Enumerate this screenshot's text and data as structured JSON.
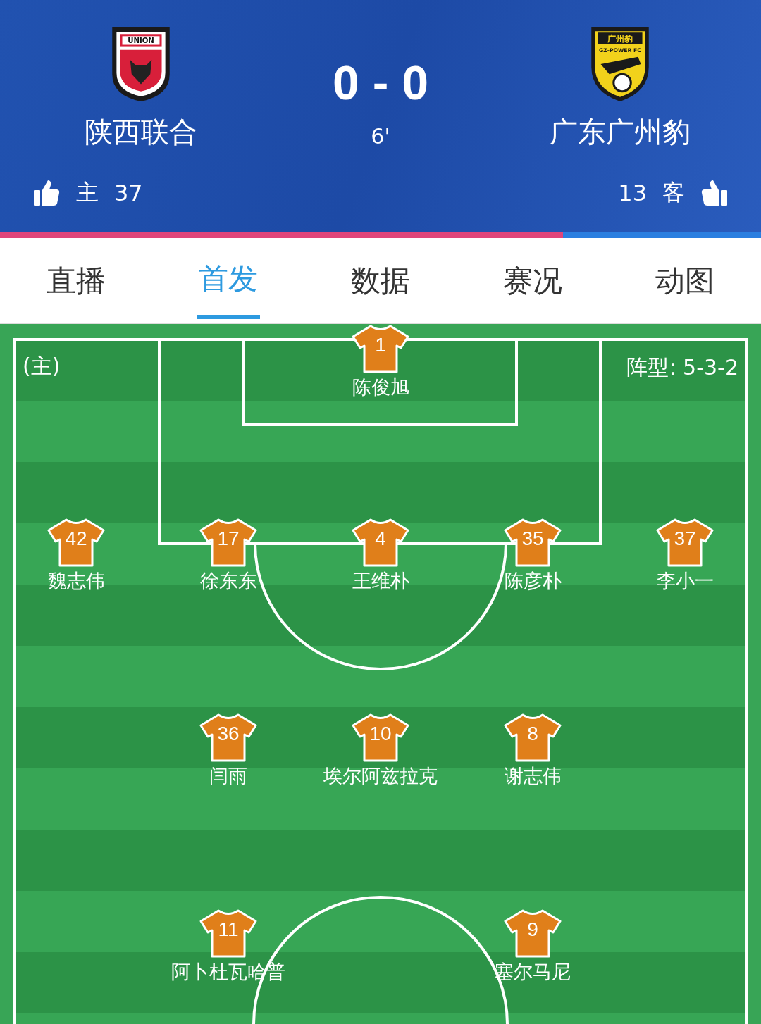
{
  "match": {
    "home": {
      "name": "陕西联合",
      "logo_text": "UNION",
      "side_label": "主",
      "likes": "37"
    },
    "away": {
      "name": "广东广州豹",
      "logo_text": "广州豹",
      "logo_subtext": "GZ-POWER FC",
      "side_label": "客",
      "likes": "13"
    },
    "score": "0 - 0",
    "minute": "6'",
    "support_bar": {
      "level": 0.74
    }
  },
  "tabs": [
    {
      "label": "直播",
      "selected": false
    },
    {
      "label": "首发",
      "selected": true
    },
    {
      "label": "数据",
      "selected": false
    },
    {
      "label": "赛况",
      "selected": false
    },
    {
      "label": "动图",
      "selected": false
    }
  ],
  "lineup": {
    "team_tag": "(主)",
    "formation": "阵型: 5-3-2",
    "rows": [
      [
        null,
        null,
        {
          "number": "1",
          "name": "陈俊旭"
        },
        null,
        null
      ],
      [
        {
          "number": "42",
          "name": "魏志伟"
        },
        {
          "number": "17",
          "name": "徐东东"
        },
        {
          "number": "4",
          "name": "王维朴"
        },
        {
          "number": "35",
          "name": "陈彦朴"
        },
        {
          "number": "37",
          "name": "李小一"
        }
      ],
      [
        null,
        {
          "number": "36",
          "name": "闫雨"
        },
        {
          "number": "10",
          "name": "埃尔阿兹拉克"
        },
        {
          "number": "8",
          "name": "谢志伟"
        },
        null
      ],
      [
        null,
        {
          "number": "11",
          "name": "阿卜杜瓦哈普"
        },
        null,
        {
          "number": "9",
          "name": "塞尔马尼"
        },
        null
      ]
    ]
  }
}
